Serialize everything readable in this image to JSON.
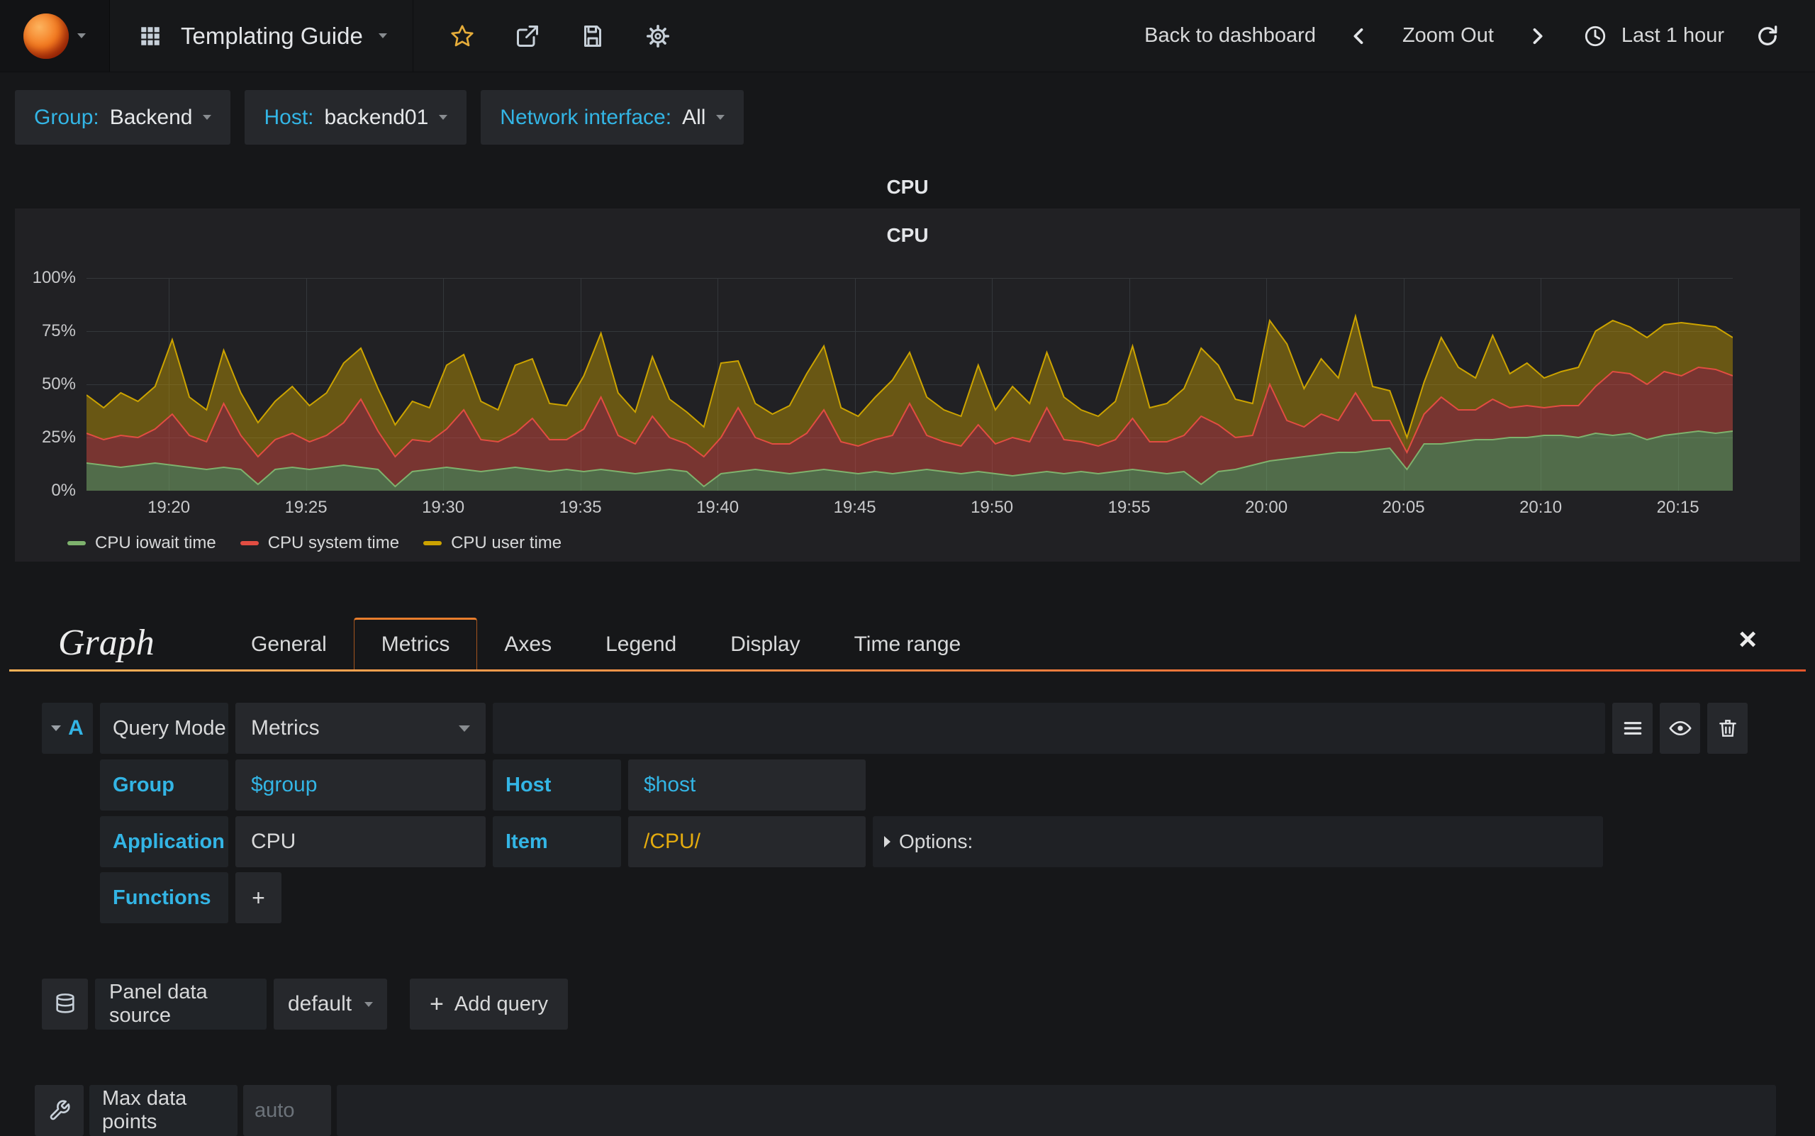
{
  "navbar": {
    "title": "Templating Guide",
    "back": "Back to dashboard",
    "zoom_out": "Zoom Out",
    "time_range": "Last 1 hour"
  },
  "variables": [
    {
      "label": "Group:",
      "value": "Backend"
    },
    {
      "label": "Host:",
      "value": "backend01"
    },
    {
      "label": "Network interface:",
      "value": "All"
    }
  ],
  "row_title": "CPU",
  "panel": {
    "title": "CPU"
  },
  "chart_data": {
    "type": "area",
    "stacked": true,
    "title": "CPU",
    "xlabel": "",
    "ylabel": "",
    "grid": true,
    "legend_position": "bottom-left",
    "y_axis": {
      "ticks": [
        "0%",
        "25%",
        "50%",
        "75%",
        "100%"
      ],
      "values": [
        0,
        25,
        50,
        75,
        100
      ],
      "max": 100
    },
    "x_axis": {
      "ticks": [
        "19:20",
        "19:25",
        "19:30",
        "19:35",
        "19:40",
        "19:45",
        "19:50",
        "19:55",
        "20:00",
        "20:05",
        "20:10",
        "20:15"
      ],
      "tick_minutes": [
        3,
        8,
        13,
        18,
        23,
        28,
        33,
        38,
        43,
        48,
        53,
        58
      ],
      "span_minutes": 60
    },
    "series": [
      {
        "name": "CPU iowait time",
        "color": "#7eb26d",
        "fill": "rgba(126,178,109,0.52)",
        "values": [
          13,
          12,
          11,
          12,
          13,
          12,
          11,
          10,
          11,
          10,
          3,
          10,
          11,
          10,
          11,
          12,
          11,
          10,
          2,
          9,
          10,
          11,
          10,
          9,
          10,
          11,
          10,
          9,
          10,
          9,
          10,
          9,
          8,
          9,
          10,
          9,
          2,
          8,
          9,
          10,
          9,
          8,
          9,
          10,
          9,
          8,
          9,
          8,
          9,
          10,
          9,
          8,
          9,
          8,
          7,
          8,
          9,
          8,
          9,
          8,
          9,
          10,
          9,
          8,
          9,
          3,
          9,
          10,
          12,
          14,
          15,
          16,
          17,
          18,
          18,
          19,
          20,
          10,
          22,
          22,
          23,
          24,
          24,
          25,
          25,
          26,
          26,
          25,
          27,
          26,
          27,
          24,
          26,
          27,
          28,
          27,
          28
        ]
      },
      {
        "name": "CPU system time",
        "color": "#e24d42",
        "fill": "rgba(226,77,66,0.45)",
        "values": [
          14,
          12,
          15,
          13,
          16,
          24,
          15,
          13,
          30,
          16,
          13,
          14,
          16,
          13,
          15,
          20,
          32,
          18,
          14,
          15,
          13,
          18,
          28,
          15,
          13,
          16,
          24,
          15,
          14,
          20,
          34,
          17,
          14,
          26,
          15,
          13,
          14,
          17,
          30,
          15,
          13,
          14,
          18,
          28,
          14,
          13,
          15,
          18,
          32,
          16,
          14,
          13,
          22,
          14,
          18,
          15,
          30,
          16,
          14,
          13,
          15,
          24,
          14,
          15,
          17,
          32,
          22,
          15,
          14,
          36,
          18,
          14,
          19,
          15,
          28,
          14,
          13,
          8,
          14,
          22,
          15,
          14,
          19,
          14,
          15,
          13,
          14,
          15,
          22,
          30,
          28,
          26,
          30,
          27,
          30,
          30,
          26
        ]
      },
      {
        "name": "CPU user time",
        "color": "#cca300",
        "fill": "rgba(204,163,0,0.42)",
        "values": [
          18,
          15,
          20,
          17,
          20,
          35,
          18,
          15,
          25,
          20,
          16,
          18,
          22,
          17,
          20,
          28,
          24,
          20,
          15,
          18,
          16,
          30,
          26,
          18,
          15,
          32,
          28,
          17,
          16,
          25,
          30,
          20,
          15,
          28,
          18,
          15,
          14,
          35,
          22,
          16,
          14,
          18,
          28,
          30,
          16,
          14,
          20,
          26,
          24,
          18,
          15,
          14,
          28,
          16,
          24,
          18,
          26,
          20,
          15,
          14,
          18,
          34,
          16,
          18,
          22,
          32,
          28,
          18,
          15,
          30,
          36,
          18,
          26,
          20,
          36,
          16,
          14,
          7,
          15,
          28,
          20,
          15,
          30,
          16,
          20,
          14,
          16,
          18,
          26,
          24,
          22,
          22,
          22,
          25,
          20,
          20,
          18
        ]
      }
    ]
  },
  "editor": {
    "title": "Graph",
    "tabs": [
      "General",
      "Metrics",
      "Axes",
      "Legend",
      "Display",
      "Time range"
    ],
    "active_tab": "Metrics",
    "close_icon": "×",
    "query": {
      "collapse_letter": "A",
      "mode_label": "Query Mode",
      "mode_value": "Metrics",
      "group_label": "Group",
      "group_value": "$group",
      "host_label": "Host",
      "host_value": "$host",
      "application_label": "Application",
      "application_value": "CPU",
      "item_label": "Item",
      "item_value": "/CPU/",
      "options_label": "Options:",
      "functions_label": "Functions",
      "add_function_label": "+"
    },
    "datasource": {
      "label": "Panel data source",
      "value": "default",
      "add_plus": "+",
      "add_query_label": "Add query"
    },
    "max_data_points": {
      "label": "Max data points",
      "placeholder": "auto"
    }
  }
}
